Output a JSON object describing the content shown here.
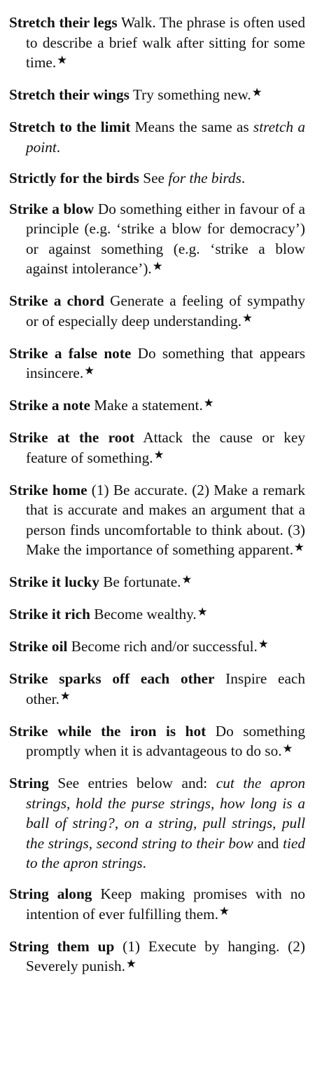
{
  "entries": [
    {
      "headword": "Stretch their legs",
      "parts": [
        {
          "text": " Walk. The phrase is often used to describe a brief walk after sitting for some time.",
          "italic": false
        }
      ],
      "star": "★"
    },
    {
      "headword": "Stretch their wings",
      "parts": [
        {
          "text": " Try something new.",
          "italic": false
        }
      ],
      "star": "★"
    },
    {
      "headword": "Stretch to the limit",
      "parts": [
        {
          "text": " Means the same as ",
          "italic": false
        },
        {
          "text": "stretch a point",
          "italic": true
        },
        {
          "text": ".",
          "italic": false
        }
      ],
      "star": ""
    },
    {
      "headword": "Strictly for the birds",
      "parts": [
        {
          "text": " See ",
          "italic": false
        },
        {
          "text": "for the birds",
          "italic": true
        },
        {
          "text": ".",
          "italic": false
        }
      ],
      "star": ""
    },
    {
      "headword": "Strike a blow",
      "parts": [
        {
          "text": " Do something either in favour of a principle (e.g. ‘strike a blow for democracy’) or against something (e.g. ‘strike a blow against intolerance’).",
          "italic": false
        }
      ],
      "star": "★"
    },
    {
      "headword": "Strike a chord",
      "parts": [
        {
          "text": " Generate a feeling of sympathy or of especially deep under­standing.",
          "italic": false
        }
      ],
      "star": "★"
    },
    {
      "headword": "Strike a false note",
      "parts": [
        {
          "text": " Do something that appears insincere.",
          "italic": false
        }
      ],
      "star": "★"
    },
    {
      "headword": "Strike a note",
      "parts": [
        {
          "text": " Make a statement.",
          "italic": false
        }
      ],
      "star": "★"
    },
    {
      "headword": "Strike at the root",
      "parts": [
        {
          "text": " Attack the cause or key feature of something.",
          "italic": false
        }
      ],
      "star": "★"
    },
    {
      "headword": "Strike home",
      "parts": [
        {
          "text": " (1) Be accurate. (2) Make a remark that is accurate and makes an argument that a person finds uncomfort­able to think about. (3) Make the impor­tance of something apparent.",
          "italic": false
        }
      ],
      "star": "★"
    },
    {
      "headword": "Strike it lucky",
      "parts": [
        {
          "text": " Be fortunate.",
          "italic": false
        }
      ],
      "star": "★"
    },
    {
      "headword": "Strike it rich",
      "parts": [
        {
          "text": " Become wealthy.",
          "italic": false
        }
      ],
      "star": "★"
    },
    {
      "headword": "Strike oil",
      "parts": [
        {
          "text": " Become rich and/or successful.",
          "italic": false
        }
      ],
      "star": "★"
    },
    {
      "headword": "Strike sparks off each other",
      "parts": [
        {
          "text": " Inspire each other.",
          "italic": false
        }
      ],
      "star": "★"
    },
    {
      "headword": "Strike while the iron is hot",
      "parts": [
        {
          "text": " Do some­thing promptly when it is advantageous to do so.",
          "italic": false
        }
      ],
      "star": "★"
    },
    {
      "headword": "String",
      "parts": [
        {
          "text": " See entries below and: ",
          "italic": false
        },
        {
          "text": "cut the apron strings, hold the purse strings, how long is a ball of string?, on a string, pull strings, pull the strings, second string to their bow",
          "italic": true
        },
        {
          "text": " and ",
          "italic": false
        },
        {
          "text": "tied to the apron strings",
          "italic": true
        },
        {
          "text": ".",
          "italic": false
        }
      ],
      "star": ""
    },
    {
      "headword": "String along",
      "parts": [
        {
          "text": " Keep making promises with no intention of ever fulfilling them.",
          "italic": false
        }
      ],
      "star": "★"
    },
    {
      "headword": "String them up",
      "parts": [
        {
          "text": " (1) Execute by hanging. (2) Severely punish.",
          "italic": false
        }
      ],
      "star": "★"
    }
  ]
}
